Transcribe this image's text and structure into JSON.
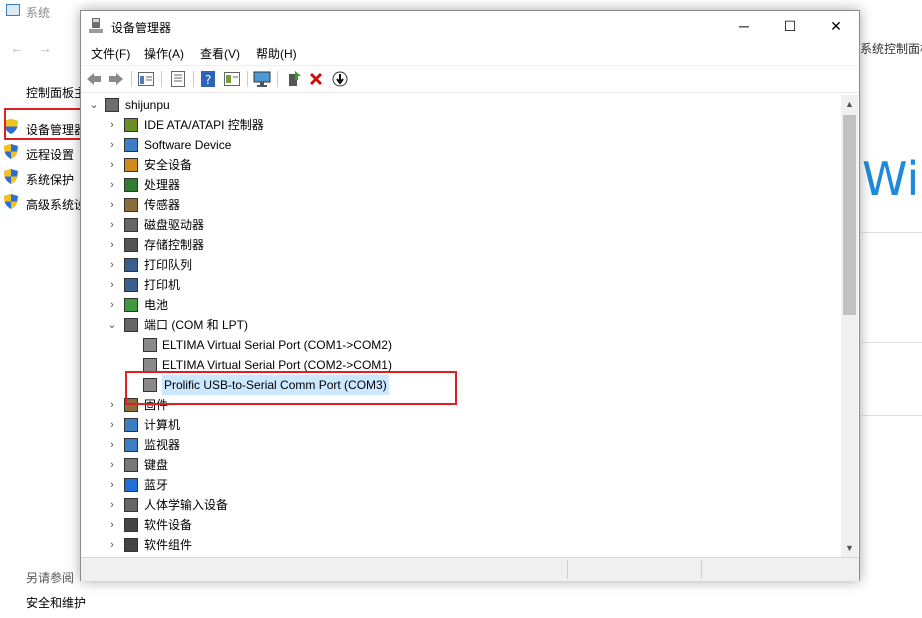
{
  "background": {
    "window_title": "系统",
    "control_panel_home": "控制面板主",
    "links": [
      "设备管理器",
      "远程设置",
      "系统保护",
      "高级系统设"
    ],
    "right_breadcrumb": "系统控制面板",
    "win_logo_text": "Wi",
    "see_also": "另请参阅",
    "security_link": "安全和维护",
    "colors": {
      "highlight": "#e02020",
      "accent": "#1f8ad8"
    }
  },
  "window": {
    "title": "设备管理器",
    "controls": {
      "minimize": "─",
      "maximize": "☐",
      "close": "✕"
    },
    "menu": [
      "文件(F)",
      "操作(A)",
      "查看(V)",
      "帮助(H)"
    ],
    "toolbar_icons": [
      "back-arrow-icon",
      "forward-arrow-icon",
      "properties-icon",
      "show-hidden-icon",
      "help-icon",
      "action-icon",
      "monitor-icon",
      "update-driver-icon",
      "uninstall-icon",
      "scan-hardware-icon"
    ]
  },
  "tree": {
    "root": "shijunpu",
    "items": [
      {
        "label": "IDE ATA/ATAPI 控制器",
        "icon": "ide-controller-icon",
        "expanded": false
      },
      {
        "label": "Software Device",
        "icon": "software-device-icon",
        "expanded": false
      },
      {
        "label": "安全设备",
        "icon": "security-device-icon",
        "expanded": false
      },
      {
        "label": "处理器",
        "icon": "processor-icon",
        "expanded": false
      },
      {
        "label": "传感器",
        "icon": "sensor-icon",
        "expanded": false
      },
      {
        "label": "磁盘驱动器",
        "icon": "disk-drive-icon",
        "expanded": false
      },
      {
        "label": "存储控制器",
        "icon": "storage-controller-icon",
        "expanded": false
      },
      {
        "label": "打印队列",
        "icon": "print-queue-icon",
        "expanded": false
      },
      {
        "label": "打印机",
        "icon": "printer-icon",
        "expanded": false
      },
      {
        "label": "电池",
        "icon": "battery-icon",
        "expanded": false
      },
      {
        "label": "端口 (COM 和 LPT)",
        "icon": "port-icon",
        "expanded": true,
        "children": [
          "ELTIMA Virtual Serial Port (COM1->COM2)",
          "ELTIMA Virtual Serial Port (COM2->COM1)",
          "Prolific USB-to-Serial Comm Port (COM3)"
        ]
      },
      {
        "label": "固件",
        "icon": "firmware-icon",
        "expanded": false
      },
      {
        "label": "计算机",
        "icon": "computer-icon",
        "expanded": false
      },
      {
        "label": "监视器",
        "icon": "monitor-icon",
        "expanded": false
      },
      {
        "label": "键盘",
        "icon": "keyboard-icon",
        "expanded": false
      },
      {
        "label": "蓝牙",
        "icon": "bluetooth-icon",
        "expanded": false
      },
      {
        "label": "人体学输入设备",
        "icon": "hid-icon",
        "expanded": false
      },
      {
        "label": "软件设备",
        "icon": "software-component-icon",
        "expanded": false
      },
      {
        "label": "软件组件",
        "icon": "software-module-icon",
        "expanded": false
      }
    ],
    "selected": "Prolific USB-to-Serial Comm Port (COM3)"
  }
}
